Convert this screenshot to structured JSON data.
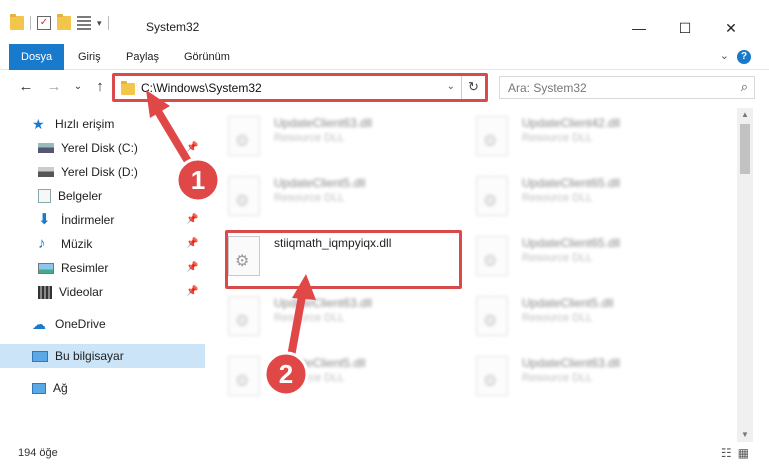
{
  "window": {
    "title": "System32",
    "minimize": "—",
    "maximize": "☐",
    "close": "✕"
  },
  "ribbon": {
    "tabs": [
      "Dosya",
      "Giriş",
      "Paylaş",
      "Görünüm"
    ],
    "help": "?",
    "collapse": "⌄"
  },
  "nav": {
    "back": "←",
    "forward": "→",
    "recent": "⌄",
    "up": "↑",
    "address": "C:\\Windows\\System32",
    "address_dropdown": "⌄",
    "refresh": "↻",
    "search_placeholder": "Ara: System32",
    "search_icon": "⌕"
  },
  "sidebar": {
    "items": [
      {
        "label": "Hızlı erişim",
        "icon": "star-icon"
      },
      {
        "label": "Yerel Disk (C:)",
        "icon": "drive-c-icon"
      },
      {
        "label": "Yerel Disk (D:)",
        "icon": "drive-d-icon"
      },
      {
        "label": "Belgeler",
        "icon": "documents-icon"
      },
      {
        "label": "İndirmeler",
        "icon": "download-icon"
      },
      {
        "label": "Müzik",
        "icon": "music-icon"
      },
      {
        "label": "Resimler",
        "icon": "pictures-icon"
      },
      {
        "label": "Videolar",
        "icon": "videos-icon"
      },
      {
        "label": "OneDrive",
        "icon": "cloud-icon"
      },
      {
        "label": "Bu bilgisayar",
        "icon": "computer-icon"
      },
      {
        "label": "Ağ",
        "icon": "network-icon"
      }
    ]
  },
  "files": [
    {
      "name": "UpdateClient63.dll",
      "type": "Resource DLL"
    },
    {
      "name": "UpdateClient42.dll",
      "type": "Resource DLL"
    },
    {
      "name": "UpdateClient5.dll",
      "type": "Resource DLL"
    },
    {
      "name": "UpdateClient65.dll",
      "type": "Resource DLL"
    },
    {
      "name": "stiiqmath_iqmpyiqx.dll",
      "type": ""
    },
    {
      "name": "UpdateClient65.dll",
      "type": "Resource DLL"
    },
    {
      "name": "UpdateClient63.dll",
      "type": "Resource DLL"
    },
    {
      "name": "UpdateClient5.dll",
      "type": "Resource DLL"
    },
    {
      "name": "UpdateClient5.dll",
      "type": "Resource DLL"
    },
    {
      "name": "UpdateClient63.dll",
      "type": "Resource DLL"
    }
  ],
  "annotations": {
    "step1": "1",
    "step2": "2",
    "color": "#e04848"
  },
  "status": {
    "count": "194 öğe",
    "details_view": "☷",
    "tiles_view": "▦"
  }
}
